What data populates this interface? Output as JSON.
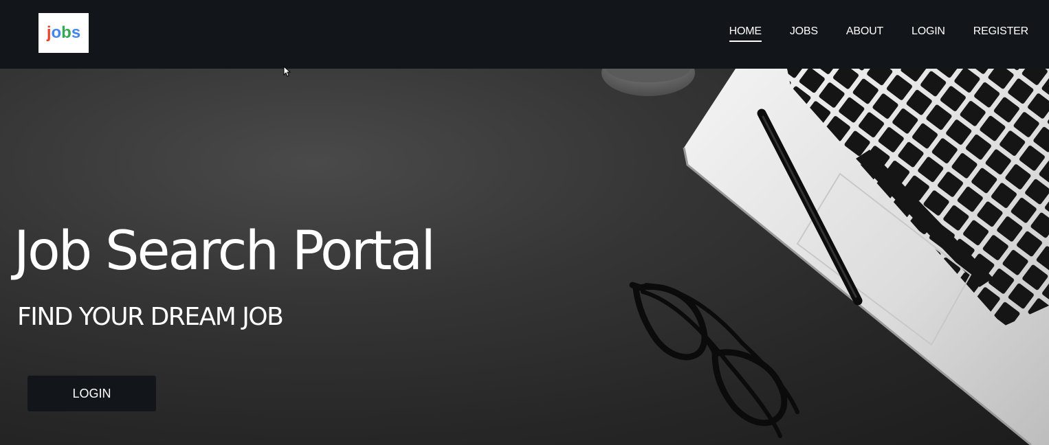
{
  "navbar": {
    "logo_text": "jobs",
    "logo_letters": [
      {
        "char": "j",
        "color": "#e8452c"
      },
      {
        "char": "o",
        "color": "#4285f4"
      },
      {
        "char": "b",
        "color": "#34a853"
      },
      {
        "char": "s",
        "color": "#4285f4"
      }
    ],
    "items": [
      {
        "label": "HOME",
        "active": true
      },
      {
        "label": "JOBS",
        "active": false
      },
      {
        "label": "ABOUT",
        "active": false
      },
      {
        "label": "LOGIN",
        "active": false
      },
      {
        "label": "REGISTER",
        "active": false
      }
    ]
  },
  "hero": {
    "title": "Job Search Portal",
    "subtitle": "FIND YOUR DREAM JOB",
    "login_label": "LOGIN",
    "background_items": [
      "laptop",
      "pen",
      "eyeglasses",
      "coffee-mug"
    ]
  },
  "colors": {
    "navbar_bg": "#12161a",
    "hero_bg": "#2b2b2b",
    "text": "#ffffff",
    "button_bg": "#12161a"
  }
}
